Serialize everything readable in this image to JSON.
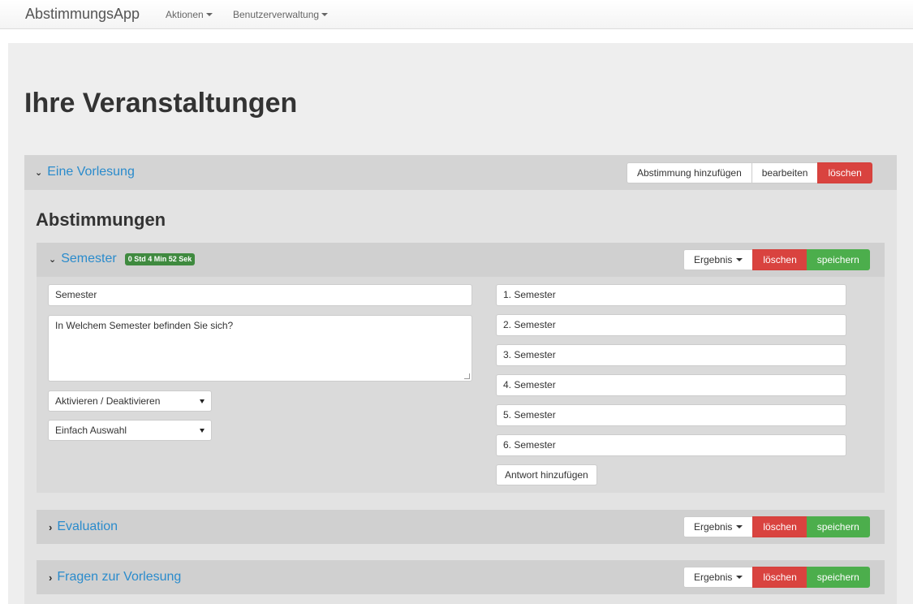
{
  "navbar": {
    "brand": "AbstimmungsApp",
    "menu": [
      {
        "label": "Aktionen"
      },
      {
        "label": "Benutzerverwaltung"
      }
    ]
  },
  "page": {
    "title": "Ihre Veranstaltungen"
  },
  "event": {
    "title": "Eine Vorlesung",
    "buttons": {
      "add_poll": "Abstimmung hinzufügen",
      "edit": "bearbeiten",
      "delete": "löschen"
    },
    "section_title": "Abstimmungen"
  },
  "polls": [
    {
      "title": "Semester",
      "timer": "0 Std 4 Min 52 Sek",
      "expanded": true,
      "buttons": {
        "result": "Ergebnis",
        "delete": "löschen",
        "save": "speichern"
      },
      "name_value": "Semester",
      "question_value": "In Welchem Semester befinden Sie sich?",
      "status_select": "Aktivieren / Deaktivieren",
      "type_select": "Einfach Auswahl",
      "answers": [
        "1. Semester",
        "2. Semester",
        "3. Semester",
        "4. Semester",
        "5. Semester",
        "6. Semester"
      ],
      "add_answer": "Antwort hinzufügen"
    },
    {
      "title": "Evaluation",
      "expanded": false,
      "buttons": {
        "result": "Ergebnis",
        "delete": "löschen",
        "save": "speichern"
      }
    },
    {
      "title": "Fragen zur Vorlesung",
      "expanded": false,
      "buttons": {
        "result": "Ergebnis",
        "delete": "löschen",
        "save": "speichern"
      }
    }
  ],
  "colors": {
    "link": "#2a8bcc",
    "danger": "#d9433f",
    "success": "#4cae4c",
    "badge": "#3f8a3f"
  }
}
